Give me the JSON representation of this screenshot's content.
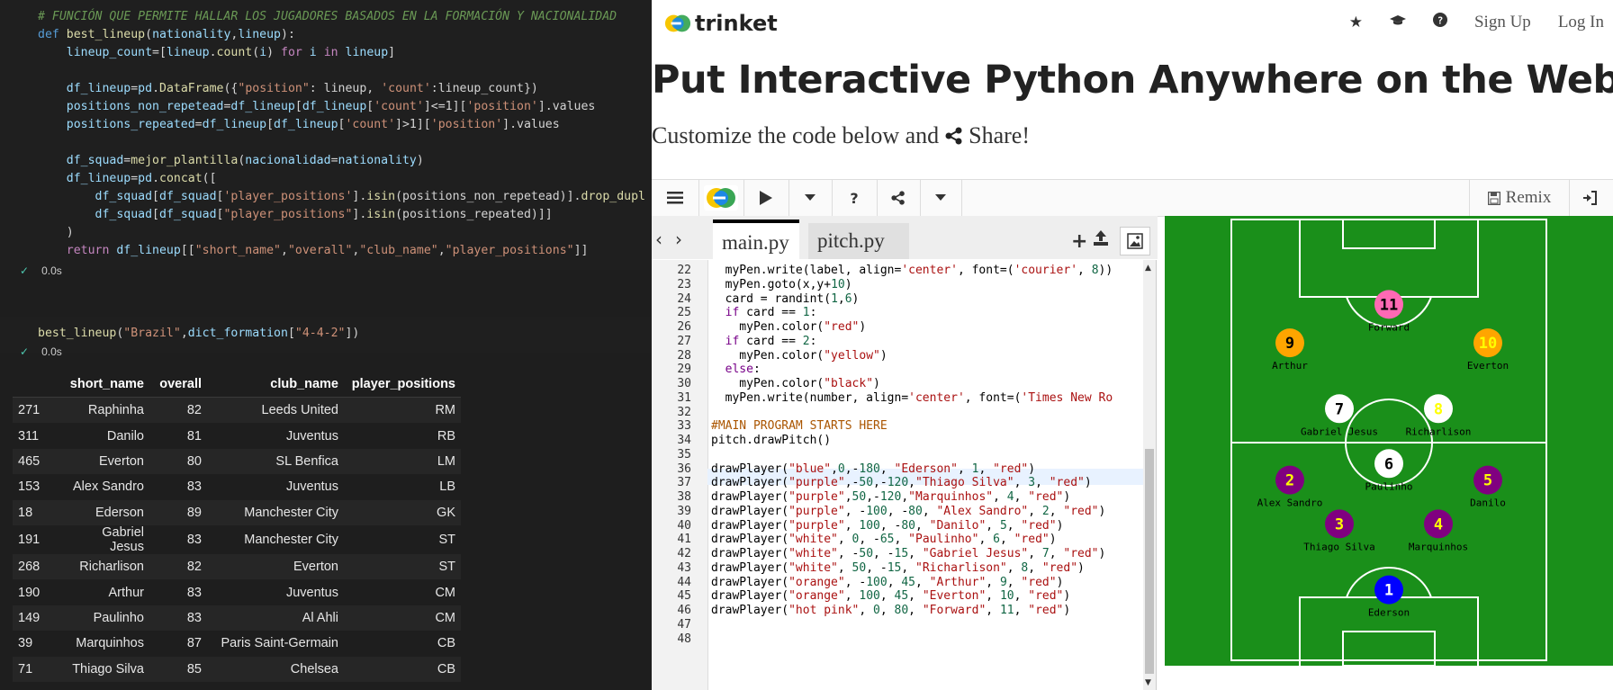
{
  "notebook": {
    "code_lines": [
      [
        {
          "t": "# FUNCIÓN QUE PERMITE HALLAR LOS JUGADORES BASADOS EN LA FORMACIÓN Y NACIONALIDAD",
          "c": "cm"
        }
      ],
      [
        {
          "t": "def ",
          "c": "kw"
        },
        {
          "t": "best_lineup",
          "c": "fn"
        },
        {
          "t": "(",
          "c": "op"
        },
        {
          "t": "nationality",
          "c": "pa"
        },
        {
          "t": ",",
          "c": "op"
        },
        {
          "t": "lineup",
          "c": "pa"
        },
        {
          "t": "):",
          "c": "op"
        }
      ],
      [
        {
          "t": "    lineup_count",
          "c": "pa"
        },
        {
          "t": "=[",
          "c": "op"
        },
        {
          "t": "lineup",
          "c": "pa"
        },
        {
          "t": ".",
          "c": "op"
        },
        {
          "t": "count",
          "c": "fn"
        },
        {
          "t": "(",
          "c": "op"
        },
        {
          "t": "i",
          "c": "pa"
        },
        {
          "t": ") ",
          "c": "op"
        },
        {
          "t": "for ",
          "c": "pk"
        },
        {
          "t": "i ",
          "c": "pa"
        },
        {
          "t": "in ",
          "c": "pk"
        },
        {
          "t": "lineup",
          "c": "pa"
        },
        {
          "t": "]",
          "c": "op"
        }
      ],
      [
        {
          "t": "",
          "c": "op"
        }
      ],
      [
        {
          "t": "    df_lineup",
          "c": "pa"
        },
        {
          "t": "=",
          "c": "op"
        },
        {
          "t": "pd",
          "c": "pa"
        },
        {
          "t": ".",
          "c": "op"
        },
        {
          "t": "DataFrame",
          "c": "fn"
        },
        {
          "t": "({",
          "c": "op"
        },
        {
          "t": "\"position\"",
          "c": "st"
        },
        {
          "t": ": lineup, ",
          "c": "op"
        },
        {
          "t": "'count'",
          "c": "st"
        },
        {
          "t": ":lineup_count})",
          "c": "op"
        }
      ],
      [
        {
          "t": "    positions_non_repetead",
          "c": "pa"
        },
        {
          "t": "=",
          "c": "op"
        },
        {
          "t": "df_lineup",
          "c": "pa"
        },
        {
          "t": "[",
          "c": "op"
        },
        {
          "t": "df_lineup",
          "c": "pa"
        },
        {
          "t": "[",
          "c": "op"
        },
        {
          "t": "'count'",
          "c": "st"
        },
        {
          "t": "]<=1][",
          "c": "op"
        },
        {
          "t": "'position'",
          "c": "st"
        },
        {
          "t": "].values",
          "c": "op"
        }
      ],
      [
        {
          "t": "    positions_repeated",
          "c": "pa"
        },
        {
          "t": "=",
          "c": "op"
        },
        {
          "t": "df_lineup",
          "c": "pa"
        },
        {
          "t": "[",
          "c": "op"
        },
        {
          "t": "df_lineup",
          "c": "pa"
        },
        {
          "t": "[",
          "c": "op"
        },
        {
          "t": "'count'",
          "c": "st"
        },
        {
          "t": "]>1][",
          "c": "op"
        },
        {
          "t": "'position'",
          "c": "st"
        },
        {
          "t": "].values",
          "c": "op"
        }
      ],
      [
        {
          "t": "",
          "c": "op"
        }
      ],
      [
        {
          "t": "    df_squad",
          "c": "pa"
        },
        {
          "t": "=",
          "c": "op"
        },
        {
          "t": "mejor_plantilla",
          "c": "fn"
        },
        {
          "t": "(",
          "c": "op"
        },
        {
          "t": "nacionalidad",
          "c": "pa"
        },
        {
          "t": "=",
          "c": "op"
        },
        {
          "t": "nationality",
          "c": "pa"
        },
        {
          "t": ")",
          "c": "op"
        }
      ],
      [
        {
          "t": "    df_lineup",
          "c": "pa"
        },
        {
          "t": "=",
          "c": "op"
        },
        {
          "t": "pd",
          "c": "pa"
        },
        {
          "t": ".",
          "c": "op"
        },
        {
          "t": "concat",
          "c": "fn"
        },
        {
          "t": "([",
          "c": "op"
        }
      ],
      [
        {
          "t": "        df_squad",
          "c": "pa"
        },
        {
          "t": "[",
          "c": "op"
        },
        {
          "t": "df_squad",
          "c": "pa"
        },
        {
          "t": "[",
          "c": "op"
        },
        {
          "t": "'player_positions'",
          "c": "st"
        },
        {
          "t": "].",
          "c": "op"
        },
        {
          "t": "isin",
          "c": "fn"
        },
        {
          "t": "(positions_non_repetead)].",
          "c": "op"
        },
        {
          "t": "drop_dupl",
          "c": "fn"
        }
      ],
      [
        {
          "t": "        df_squad",
          "c": "pa"
        },
        {
          "t": "[",
          "c": "op"
        },
        {
          "t": "df_squad",
          "c": "pa"
        },
        {
          "t": "[",
          "c": "op"
        },
        {
          "t": "\"player_positions\"",
          "c": "st"
        },
        {
          "t": "].",
          "c": "op"
        },
        {
          "t": "isin",
          "c": "fn"
        },
        {
          "t": "(positions_repeated)]]",
          "c": "op"
        }
      ],
      [
        {
          "t": "    )",
          "c": "op"
        }
      ],
      [
        {
          "t": "    return ",
          "c": "pk"
        },
        {
          "t": "df_lineup",
          "c": "pa"
        },
        {
          "t": "[[",
          "c": "op"
        },
        {
          "t": "\"short_name\"",
          "c": "st"
        },
        {
          "t": ",",
          "c": "op"
        },
        {
          "t": "\"overall\"",
          "c": "st"
        },
        {
          "t": ",",
          "c": "op"
        },
        {
          "t": "\"club_name\"",
          "c": "st"
        },
        {
          "t": ",",
          "c": "op"
        },
        {
          "t": "\"player_positions\"",
          "c": "st"
        },
        {
          "t": "]]",
          "c": "op"
        }
      ]
    ],
    "exec_time_1": "0.0s",
    "call_line": [
      {
        "t": "best_lineup",
        "c": "fn"
      },
      {
        "t": "(",
        "c": "op"
      },
      {
        "t": "\"Brazil\"",
        "c": "st"
      },
      {
        "t": ",",
        "c": "op"
      },
      {
        "t": "dict_formation",
        "c": "pa"
      },
      {
        "t": "[",
        "c": "op"
      },
      {
        "t": "\"4-4-2\"",
        "c": "st"
      },
      {
        "t": "])",
        "c": "op"
      }
    ],
    "exec_time_2": "0.0s",
    "table": {
      "headers": [
        "",
        "short_name",
        "overall",
        "club_name",
        "player_positions"
      ],
      "rows": [
        [
          "271",
          "Raphinha",
          "82",
          "Leeds United",
          "RM"
        ],
        [
          "311",
          "Danilo",
          "81",
          "Juventus",
          "RB"
        ],
        [
          "465",
          "Everton",
          "80",
          "SL Benfica",
          "LM"
        ],
        [
          "153",
          "Alex Sandro",
          "83",
          "Juventus",
          "LB"
        ],
        [
          "18",
          "Ederson",
          "89",
          "Manchester City",
          "GK"
        ],
        [
          "191",
          "Gabriel Jesus",
          "83",
          "Manchester City",
          "ST"
        ],
        [
          "268",
          "Richarlison",
          "82",
          "Everton",
          "ST"
        ],
        [
          "190",
          "Arthur",
          "83",
          "Juventus",
          "CM"
        ],
        [
          "149",
          "Paulinho",
          "83",
          "Al Ahli",
          "CM"
        ],
        [
          "39",
          "Marquinhos",
          "87",
          "Paris Saint-Germain",
          "CB"
        ],
        [
          "71",
          "Thiago Silva",
          "85",
          "Chelsea",
          "CB"
        ]
      ]
    }
  },
  "trinket": {
    "brand": "trinket",
    "nav": {
      "sign_up": "Sign Up",
      "log_in": "Log In"
    },
    "headline": "Put Interactive Python Anywhere on the Web",
    "subtitle_pre": "Customize the code below and",
    "subtitle_share": "Share!",
    "toolbar": {
      "remix": "Remix"
    },
    "tabs": [
      "main.py",
      "pitch.py"
    ],
    "editor": {
      "lines": [
        {
          "n": "22",
          "html": "  myPen.write(label, align=<span class='c-str'>'center'</span>, font=(<span class='c-str'>'courier'</span>, <span class='c-num'>8</span>))"
        },
        {
          "n": "23",
          "html": "  myPen.goto(x,y+<span class='c-num'>10</span>)"
        },
        {
          "n": "24",
          "html": "  card = randint(<span class='c-num'>1</span>,<span class='c-num'>6</span>)"
        },
        {
          "n": "25",
          "html": "  <span class='c-kw'>if</span> card == <span class='c-num'>1</span>:"
        },
        {
          "n": "26",
          "html": "    myPen.color(<span class='c-str'>\"red\"</span>)"
        },
        {
          "n": "27",
          "html": "  <span class='c-kw'>if</span> card == <span class='c-num'>2</span>:"
        },
        {
          "n": "28",
          "html": "    myPen.color(<span class='c-str'>\"yellow\"</span>)"
        },
        {
          "n": "29",
          "html": "  <span class='c-kw'>else</span>:"
        },
        {
          "n": "30",
          "html": "    myPen.color(<span class='c-str'>\"black\"</span>)"
        },
        {
          "n": "31",
          "html": "  myPen.write(number, align=<span class='c-str'>'center'</span>, font=(<span class='c-str'>'Times New Ro</span>"
        },
        {
          "n": "32",
          "html": ""
        },
        {
          "n": "33",
          "html": "<span class='c-cm'>#MAIN PROGRAM STARTS HERE</span>"
        },
        {
          "n": "34",
          "html": "pitch.drawPitch()"
        },
        {
          "n": "35",
          "html": ""
        },
        {
          "n": "36",
          "html": "drawPlayer(<span class='c-str'>\"blue\"</span>,<span class='c-num'>0</span>,-<span class='c-num'>180</span>, <span class='c-str'>\"Ederson\"</span>, <span class='c-num'>1</span>, <span class='c-str'>\"red\"</span>)"
        },
        {
          "n": "37",
          "html": "drawPlayer(<span class='c-str'>\"purple\"</span>,-<span class='c-num'>50</span>,-<span class='c-num'>120</span>,<span class='c-str'>\"Thiago Silva\"</span>, <span class='c-num'>3</span>, <span class='c-str'>\"red\"</span>)"
        },
        {
          "n": "38",
          "html": "drawPlayer(<span class='c-str'>\"purple\"</span>,<span class='c-num'>50</span>,-<span class='c-num'>120</span>,<span class='c-str'>\"Marquinhos\"</span>, <span class='c-num'>4</span>, <span class='c-str'>\"red\"</span>)"
        },
        {
          "n": "39",
          "html": "drawPlayer(<span class='c-str'>\"purple\"</span>, -<span class='c-num'>100</span>, -<span class='c-num'>80</span>, <span class='c-str'>\"Alex Sandro\"</span>, <span class='c-num'>2</span>, <span class='c-str'>\"red\"</span>)"
        },
        {
          "n": "40",
          "html": "drawPlayer(<span class='c-str'>\"purple\"</span>, <span class='c-num'>100</span>, -<span class='c-num'>80</span>, <span class='c-str'>\"Danilo\"</span>, <span class='c-num'>5</span>, <span class='c-str'>\"red\"</span>)"
        },
        {
          "n": "41",
          "html": "drawPlayer(<span class='c-str'>\"white\"</span>, <span class='c-num'>0</span>, -<span class='c-num'>65</span>, <span class='c-str'>\"Paulinho\"</span>, <span class='c-num'>6</span>, <span class='c-str'>\"red\"</span>)"
        },
        {
          "n": "42",
          "html": "drawPlayer(<span class='c-str'>\"white\"</span>, -<span class='c-num'>50</span>, -<span class='c-num'>15</span>, <span class='c-str'>\"Gabriel Jesus\"</span>, <span class='c-num'>7</span>, <span class='c-str'>\"red\"</span>)"
        },
        {
          "n": "43",
          "html": "drawPlayer(<span class='c-str'>\"white\"</span>, <span class='c-num'>50</span>, -<span class='c-num'>15</span>, <span class='c-str'>\"Richarlison\"</span>, <span class='c-num'>8</span>, <span class='c-str'>\"red\"</span>)"
        },
        {
          "n": "44",
          "html": "drawPlayer(<span class='c-str'>\"orange\"</span>, -<span class='c-num'>100</span>, <span class='c-num'>45</span>, <span class='c-str'>\"Arthur\"</span>, <span class='c-num'>9</span>, <span class='c-str'>\"red\"</span>)"
        },
        {
          "n": "45",
          "html": "drawPlayer(<span class='c-str'>\"orange\"</span>, <span class='c-num'>100</span>, <span class='c-num'>45</span>, <span class='c-str'>\"Everton\"</span>, <span class='c-num'>10</span>, <span class='c-str'>\"red\"</span>)"
        },
        {
          "n": "46",
          "html": "drawPlayer(<span class='c-str'>\"hot pink\"</span>, <span class='c-num'>0</span>, <span class='c-num'>80</span>, <span class='c-str'>\"Forward\"</span>, <span class='c-num'>11</span>, <span class='c-str'>\"red\"</span>)"
        },
        {
          "n": "47",
          "html": ""
        },
        {
          "n": "48",
          "html": ""
        }
      ]
    },
    "pitch": {
      "colors": {
        "grass": "#1a8f1a",
        "lines": "#ffffff"
      },
      "players": [
        {
          "name": "Ederson",
          "number": "1",
          "color": "#0000ff",
          "numcolor": "#ffffff"
        },
        {
          "name": "Thiago Silva",
          "number": "3",
          "color": "#800080",
          "numcolor": "#ffff00"
        },
        {
          "name": "Marquinhos",
          "number": "4",
          "color": "#800080",
          "numcolor": "#ffff00"
        },
        {
          "name": "Alex Sandro",
          "number": "2",
          "color": "#800080",
          "numcolor": "#ffff00"
        },
        {
          "name": "Danilo",
          "number": "5",
          "color": "#800080",
          "numcolor": "#ffff00"
        },
        {
          "name": "Paulinho",
          "number": "6",
          "color": "#ffffff",
          "numcolor": "#000000"
        },
        {
          "name": "Gabriel Jesus",
          "number": "7",
          "color": "#ffffff",
          "numcolor": "#000000"
        },
        {
          "name": "Richarlison",
          "number": "8",
          "color": "#ffffff",
          "numcolor": "#ffff00"
        },
        {
          "name": "Arthur",
          "number": "9",
          "color": "#ffa500",
          "numcolor": "#000000"
        },
        {
          "name": "Everton",
          "number": "10",
          "color": "#ffa500",
          "numcolor": "#ffff00"
        },
        {
          "name": "Forward",
          "number": "11",
          "color": "#ff69b4",
          "numcolor": "#000000"
        }
      ]
    }
  }
}
